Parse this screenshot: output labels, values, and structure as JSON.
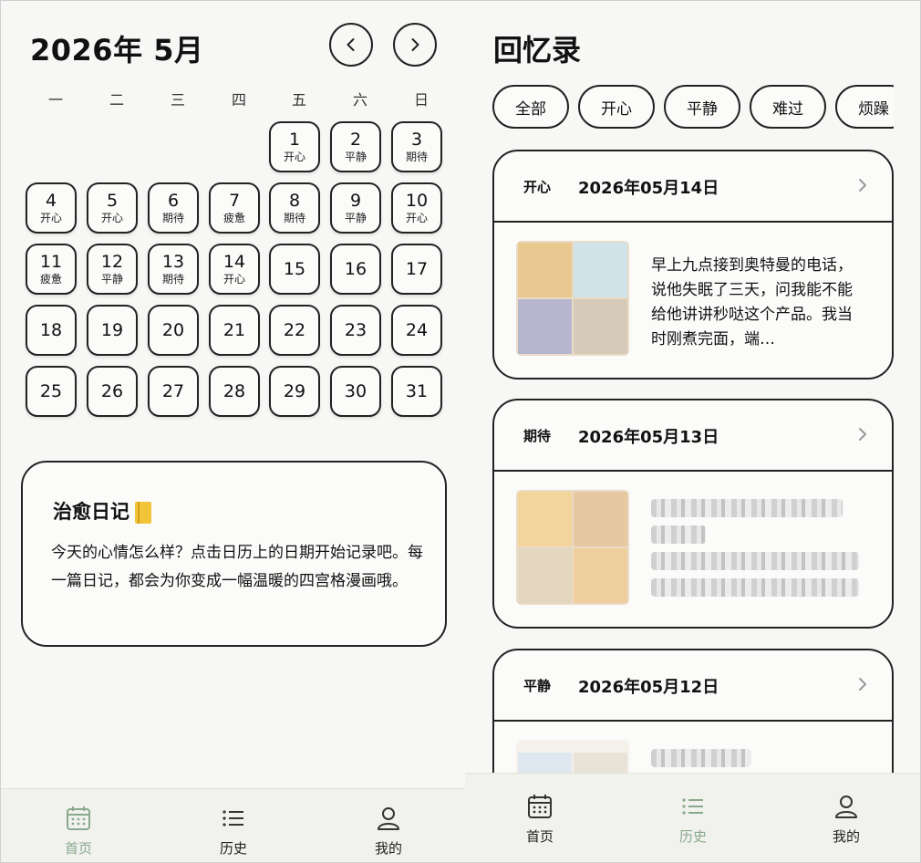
{
  "calendar": {
    "title": "2026年 5月",
    "prev_label": "‹",
    "next_label": "›",
    "weekdays": [
      "一",
      "二",
      "三",
      "四",
      "五",
      "六",
      "日"
    ],
    "days": [
      {
        "num": "1",
        "mood": "开心"
      },
      {
        "num": "2",
        "mood": "平静"
      },
      {
        "num": "3",
        "mood": "期待"
      },
      {
        "num": "4",
        "mood": "开心"
      },
      {
        "num": "5",
        "mood": "开心"
      },
      {
        "num": "6",
        "mood": "期待"
      },
      {
        "num": "7",
        "mood": "疲惫"
      },
      {
        "num": "8",
        "mood": "期待"
      },
      {
        "num": "9",
        "mood": "平静"
      },
      {
        "num": "10",
        "mood": "开心"
      },
      {
        "num": "11",
        "mood": "疲惫"
      },
      {
        "num": "12",
        "mood": "平静"
      },
      {
        "num": "13",
        "mood": "期待"
      },
      {
        "num": "14",
        "mood": "开心"
      },
      {
        "num": "15",
        "mood": ""
      },
      {
        "num": "16",
        "mood": ""
      },
      {
        "num": "17",
        "mood": ""
      },
      {
        "num": "18",
        "mood": ""
      },
      {
        "num": "19",
        "mood": ""
      },
      {
        "num": "20",
        "mood": ""
      },
      {
        "num": "21",
        "mood": ""
      },
      {
        "num": "22",
        "mood": ""
      },
      {
        "num": "23",
        "mood": ""
      },
      {
        "num": "24",
        "mood": ""
      },
      {
        "num": "25",
        "mood": ""
      },
      {
        "num": "26",
        "mood": ""
      },
      {
        "num": "27",
        "mood": ""
      },
      {
        "num": "28",
        "mood": ""
      },
      {
        "num": "29",
        "mood": ""
      },
      {
        "num": "30",
        "mood": ""
      },
      {
        "num": "31",
        "mood": ""
      }
    ]
  },
  "healing_card": {
    "title": "治愈日记",
    "icon": "notebook-icon",
    "text": "今天的心情怎么样？点击日历上的日期开始记录吧。每一篇日记，都会为你变成一幅温暖的四宫格漫画哦。"
  },
  "memories": {
    "title": "回忆录",
    "filters": [
      "全部",
      "开心",
      "平静",
      "难过",
      "烦躁"
    ],
    "entries": [
      {
        "mood": "开心",
        "date": "2026年05月14日",
        "text": "早上九点接到奥特曼的电话，说他失眠了三天，问我能不能给他讲讲秒哒这个产品。我当时刚煮完面，端…"
      },
      {
        "mood": "期待",
        "date": "2026年05月13日",
        "text": ""
      },
      {
        "mood": "平静",
        "date": "2026年05月12日",
        "text": ""
      }
    ]
  },
  "tabbar": {
    "home": "首页",
    "history": "历史",
    "mine": "我的"
  },
  "colors": {
    "accent_green": "#8aa98d",
    "border": "#222222",
    "background": "#f7f7f5"
  }
}
